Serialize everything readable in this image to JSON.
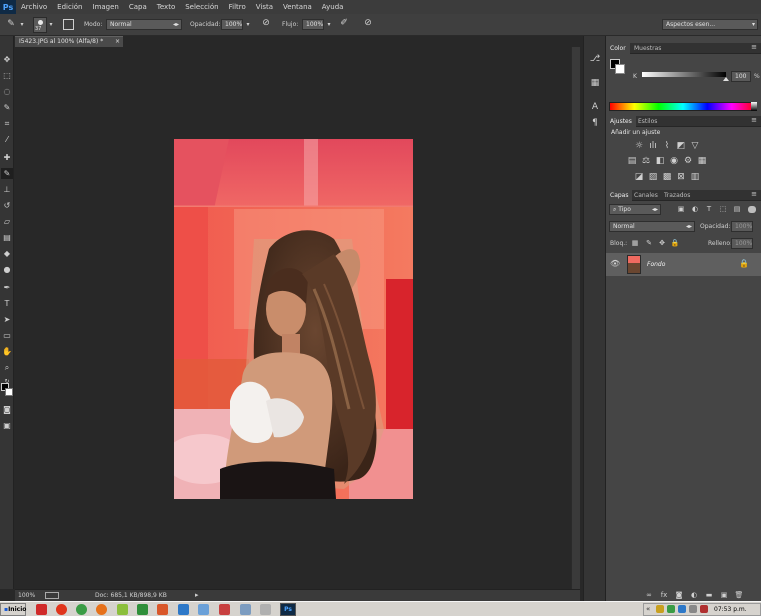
{
  "menubar": {
    "logo": "Ps",
    "items": [
      "Archivo",
      "Edición",
      "Imagen",
      "Capa",
      "Texto",
      "Selección",
      "Filtro",
      "Vista",
      "Ventana",
      "Ayuda"
    ]
  },
  "options": {
    "brush_size": "37",
    "modo_label": "Modo:",
    "modo_value": "Normal",
    "opacidad_label": "Opacidad:",
    "opacidad_value": "100%",
    "flujo_label": "Flujo:",
    "flujo_value": "100%",
    "workspace": "Aspectos esen..."
  },
  "document": {
    "tab_title": "I5423.JPG al 100% (Alfa/8) *",
    "close": "×",
    "zoom": "100%",
    "doc_info": "Doc: 685,1 KB/898,9 KB"
  },
  "color_panel": {
    "tabs": [
      "Color",
      "Muestras"
    ],
    "channel": "K",
    "value": "100",
    "unit": "%"
  },
  "adjust_panel": {
    "tabs": [
      "Ajustes",
      "Estilos"
    ],
    "heading": "Añadir un ajuste"
  },
  "layers_panel": {
    "tabs": [
      "Capas",
      "Canales",
      "Trazados"
    ],
    "filter": "Tipo",
    "blend": "Normal",
    "opacity_label": "Opacidad:",
    "opacity_value": "100%",
    "lock_label": "Bloq.:",
    "fill_label": "Relleno:",
    "fill_value": "100%",
    "layer_name": "Fondo"
  },
  "taskbar": {
    "start": "Inicio",
    "clock": "07:53 p.m.",
    "ps_label": "Ps"
  },
  "colors": {
    "menubar": "#3c3c3c",
    "panel": "#454545",
    "canvas_bg": "#282828",
    "wall": "#ef5a52"
  }
}
